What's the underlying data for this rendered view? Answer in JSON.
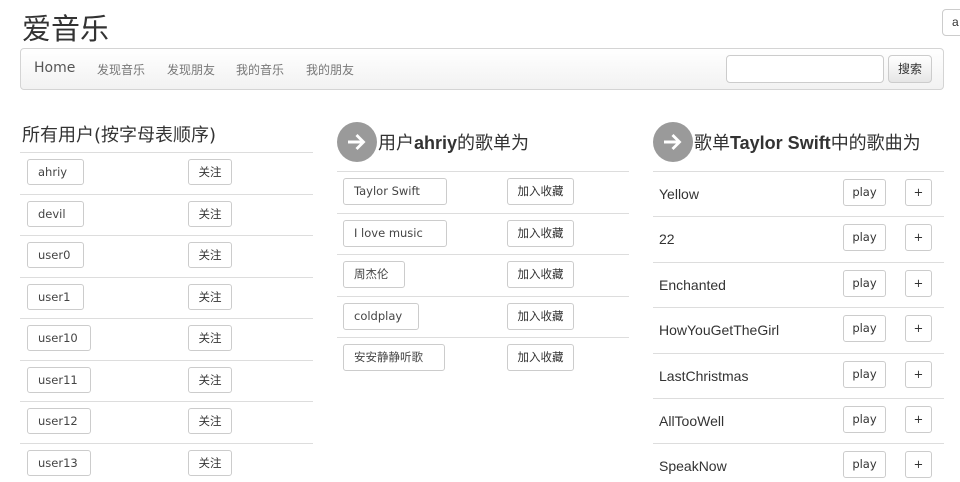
{
  "app": {
    "title": "爱音乐",
    "corner_button": "a"
  },
  "navbar": {
    "home": "Home",
    "items": [
      "发现音乐",
      "发现朋友",
      "我的音乐",
      "我的朋友"
    ],
    "search_placeholder": "",
    "search_button": "搜索"
  },
  "users_panel": {
    "title": "所有用户(按字母表顺序)",
    "follow_label": "关注",
    "users": [
      "ahriy",
      "devil",
      "user0",
      "user1",
      "user10",
      "user11",
      "user12",
      "user13"
    ]
  },
  "playlists_panel": {
    "title_prefix": "用户",
    "username": "ahriy",
    "title_suffix": "的歌单为",
    "add_label": "加入收藏",
    "playlists": [
      "Taylor Swift",
      "I love music",
      "周杰伦",
      "coldplay",
      "安安静静听歌"
    ]
  },
  "songs_panel": {
    "title_prefix": "歌单",
    "playlist": "Taylor Swift",
    "title_suffix": "中的歌曲为",
    "play_label": "play",
    "add_label": "+",
    "songs": [
      "Yellow",
      "22",
      "Enchanted",
      "HowYouGetTheGirl",
      "LastChristmas",
      "AllTooWell",
      "SpeakNow"
    ]
  },
  "icons": {
    "arrow": "arrow-right-circle-icon"
  }
}
